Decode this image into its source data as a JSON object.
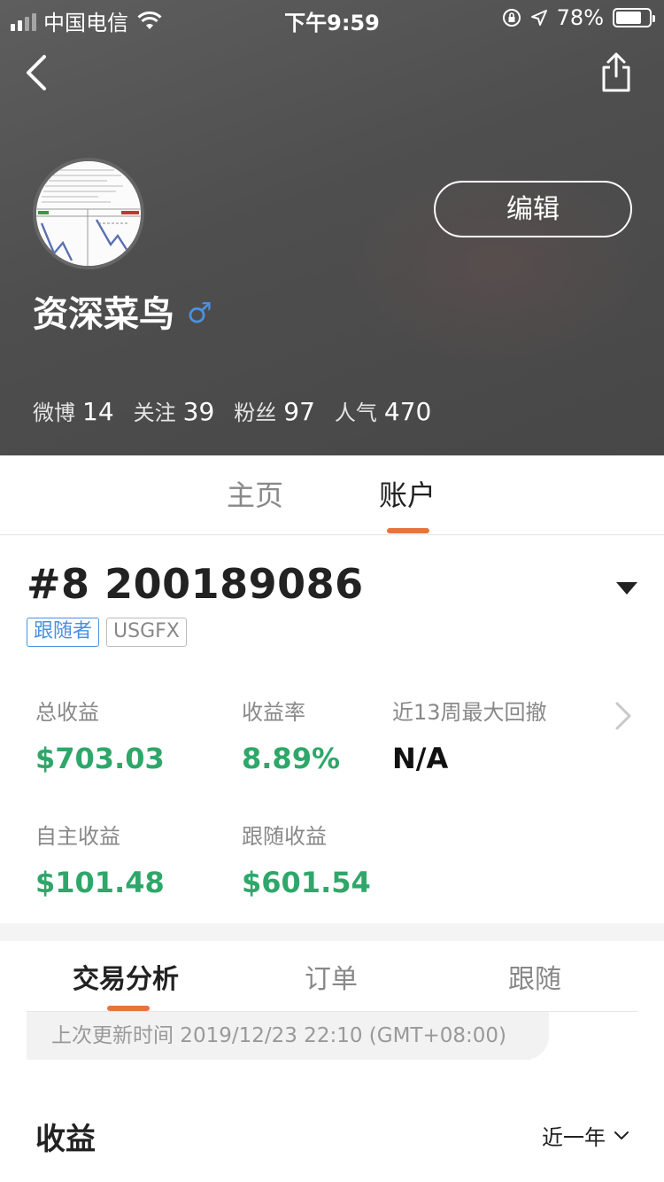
{
  "status_bar": {
    "carrier": "中国电信",
    "time": "下午9:59",
    "battery_percent": "78%",
    "battery_level": 0.78
  },
  "profile": {
    "username": "资深菜鸟",
    "gender_symbol": "♂",
    "edit_label": "编辑",
    "stats": [
      {
        "label": "微博",
        "value": "14"
      },
      {
        "label": "关注",
        "value": "39"
      },
      {
        "label": "粉丝",
        "value": "97"
      },
      {
        "label": "人气",
        "value": "470"
      }
    ]
  },
  "main_tabs": [
    {
      "label": "主页",
      "active": false
    },
    {
      "label": "账户",
      "active": true
    }
  ],
  "account": {
    "id": "#8 200189086",
    "tags": [
      "跟随者",
      "USGFX"
    ],
    "metrics": [
      {
        "label": "总收益",
        "value": "$703.03"
      },
      {
        "label": "收益率",
        "value": "8.89%"
      },
      {
        "label": "近13周最大回撤",
        "value": "N/A"
      },
      {
        "label": "自主收益",
        "value": "$101.48"
      },
      {
        "label": "跟随收益",
        "value": "$601.54"
      }
    ]
  },
  "analysis_tabs": [
    {
      "label": "交易分析",
      "active": true
    },
    {
      "label": "订单",
      "active": false
    },
    {
      "label": "跟随",
      "active": false
    }
  ],
  "last_update": "上次更新时间 2019/12/23 22:10 (GMT+08:00)",
  "earnings": {
    "title": "收益",
    "period": "近一年"
  },
  "colors": {
    "accent": "#e8743b",
    "positive": "#2fa76a",
    "link_blue": "#4a90e2"
  }
}
